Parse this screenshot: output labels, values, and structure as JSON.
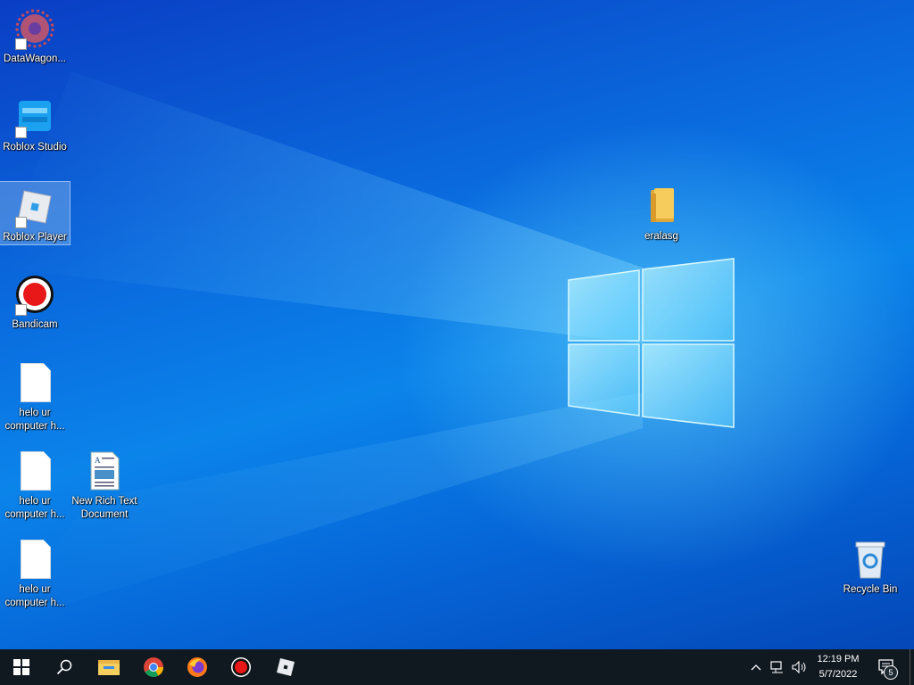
{
  "desktop": {
    "icons": [
      {
        "label": "DataWagon..."
      },
      {
        "label": "Roblox Studio"
      },
      {
        "label": "Roblox Player"
      },
      {
        "label": "Bandicam"
      },
      {
        "label": "helo ur computer h..."
      },
      {
        "label": "helo ur computer h..."
      },
      {
        "label": "New Rich Text Document"
      },
      {
        "label": "helo ur computer h..."
      },
      {
        "label": "eralasg"
      },
      {
        "label": "Recycle Bin"
      }
    ]
  },
  "taskbar": {
    "apps": [
      "start-icon",
      "search-icon",
      "file-explorer-icon",
      "chrome-icon",
      "firefox-icon",
      "bandicam-icon",
      "roblox-icon"
    ],
    "clock": {
      "time": "12:19 PM",
      "date": "5/7/2022"
    },
    "notifications": {
      "count": "5"
    }
  },
  "colors": {
    "taskbar": "#101820",
    "accent": "#0b84ea"
  }
}
